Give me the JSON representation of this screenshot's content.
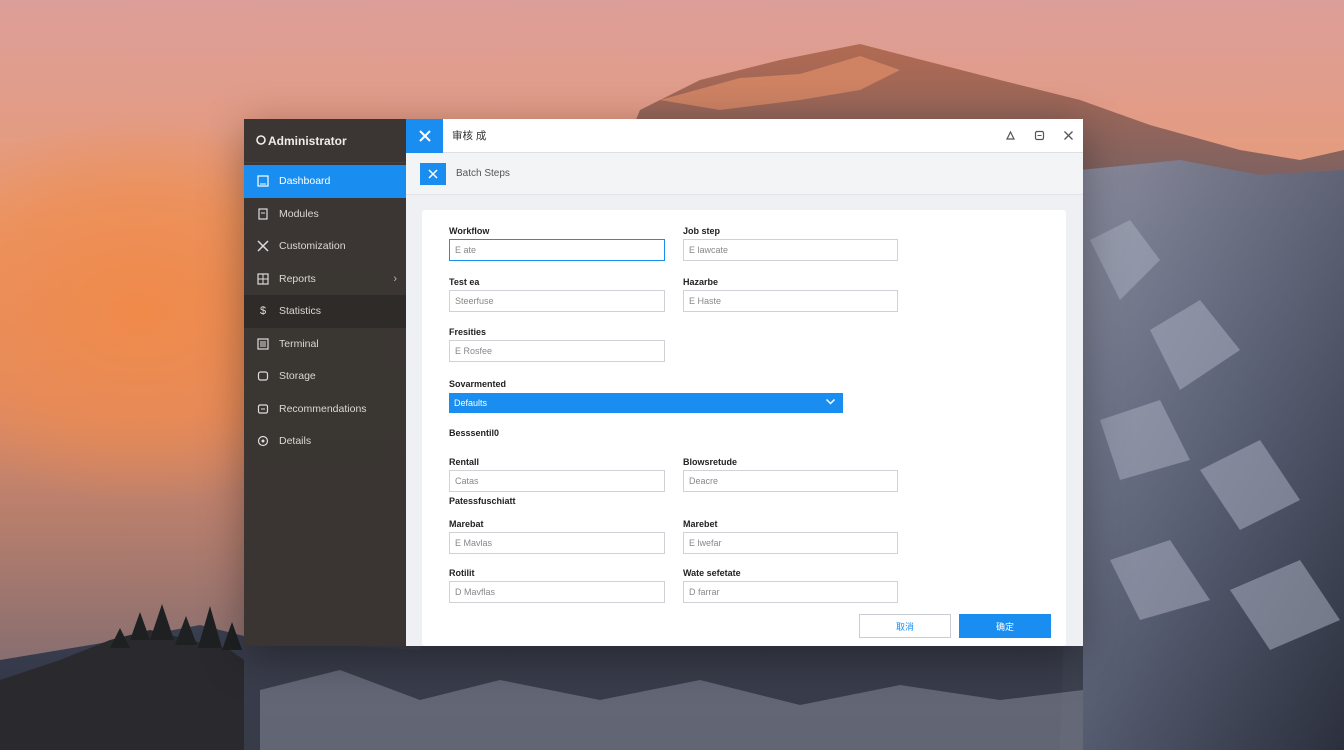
{
  "desktop": {
    "wallpaper": "sunset-mountain"
  },
  "sidebar": {
    "title": "Administrator",
    "items": [
      {
        "label": "Dashboard",
        "icon": "square-icon",
        "active": true
      },
      {
        "label": "Modules",
        "icon": "document-icon"
      },
      {
        "label": "Customization",
        "icon": "tools-icon"
      },
      {
        "label": "Reports",
        "icon": "grid-icon",
        "has_submenu": true
      },
      {
        "label": "Statistics",
        "icon": "dollar-icon",
        "hover": true
      },
      {
        "label": "Terminal",
        "icon": "list-icon"
      },
      {
        "label": "Storage",
        "icon": "box-icon"
      },
      {
        "label": "Recommendations",
        "icon": "folder-icon"
      },
      {
        "label": "Details",
        "icon": "gear-icon"
      }
    ]
  },
  "titlebar": {
    "title": "审核 成",
    "icon": "tools-icon"
  },
  "toolbar": {
    "label": "Batch Steps"
  },
  "form": {
    "fields": [
      {
        "label": "Workflow",
        "placeholder": "E ate"
      },
      {
        "label": "Job step",
        "placeholder": "E lawcate"
      },
      {
        "label": "Test ea",
        "placeholder": "Steerfuse"
      },
      {
        "label": "Hazarbe",
        "placeholder": "E Haste"
      },
      {
        "label": "Fresities",
        "placeholder": "E Rosfee"
      }
    ],
    "select_label": "Sovarmented",
    "select_value": "Defaults",
    "section_1": "Besssentil0",
    "fields_2": [
      {
        "label": "Rentall",
        "placeholder": "Catas"
      },
      {
        "label": "Blowsretude",
        "placeholder": "Deacre"
      }
    ],
    "section_2": "Patessfuschiatt",
    "fields_3": [
      {
        "label": "Marebat",
        "placeholder": "E Mavlas"
      },
      {
        "label": "Marebet",
        "placeholder": "E lwefar"
      },
      {
        "label": "Rotilit",
        "placeholder": "D Mavflas"
      },
      {
        "label": "Wate sefetate",
        "placeholder": "D farrar"
      }
    ]
  },
  "actions": {
    "cancel": "取消",
    "ok": "确定"
  },
  "colors": {
    "accent": "#1a8ef0",
    "sidebar": "#3b3633"
  }
}
